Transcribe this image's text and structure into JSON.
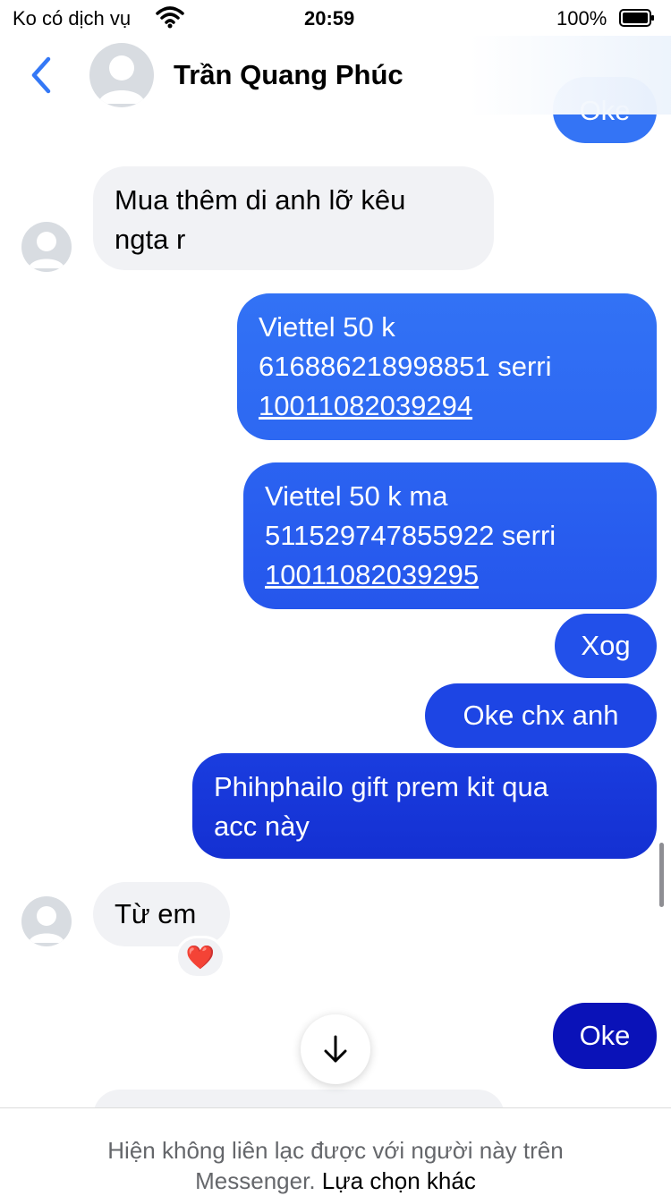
{
  "status_bar": {
    "carrier": "Ko có dịch vụ",
    "time": "20:59",
    "battery": "100%"
  },
  "header": {
    "contact_name": "Trần Quang Phúc",
    "accent_color": "#3478f6"
  },
  "messages": [
    {
      "from": "me",
      "text": "Oke"
    },
    {
      "from": "them",
      "lines": [
        "Mua thêm di anh lỡ kêu",
        "ngta r"
      ]
    },
    {
      "from": "me",
      "lines": [
        "Viettel  50 k",
        "616886218998851 serri"
      ],
      "link": "10011082039294"
    },
    {
      "from": "me",
      "lines": [
        "Viettel 50 k ma",
        "511529747855922 serri"
      ],
      "link": "10011082039295"
    },
    {
      "from": "me",
      "text": "Xog"
    },
    {
      "from": "me",
      "text": "Oke chx anh"
    },
    {
      "from": "me",
      "lines": [
        "Phihphailo gift prem kit qua",
        "acc này"
      ]
    },
    {
      "from": "them",
      "text": "Từ em",
      "reaction": "❤️"
    },
    {
      "from": "me",
      "text": "Oke"
    }
  ],
  "footer": {
    "notice": "Hiện không liên lạc được với người này trên",
    "notice_2": "Messenger.",
    "alternative_link": "Lựa chọn khác"
  },
  "colors": {
    "outgoing_top": "#3478f6",
    "outgoing_bottom": "#0a12b8",
    "incoming": "#f1f2f5"
  }
}
